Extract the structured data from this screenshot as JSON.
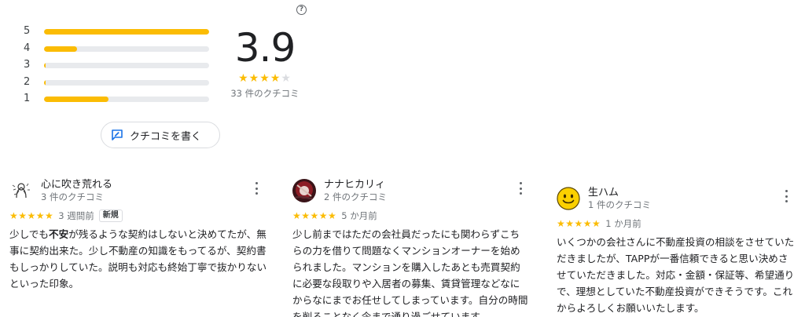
{
  "summary": {
    "distribution": [
      {
        "label": "5",
        "fraction": 1.0
      },
      {
        "label": "4",
        "fraction": 0.2
      },
      {
        "label": "3",
        "fraction": 0.01
      },
      {
        "label": "2",
        "fraction": 0.01
      },
      {
        "label": "1",
        "fraction": 0.39
      }
    ],
    "average": "3.9",
    "stars_display": "★★★★",
    "stars_empty": "★",
    "rating_value": 3.9,
    "count_text": "33 件のクチコミ",
    "help_icon_text": "?"
  },
  "write_review": {
    "label": "クチコミを書く"
  },
  "reviews": [
    {
      "name": "心に吹き荒れる",
      "sub": "3 件のクチコミ",
      "stars": "★★★★★",
      "date": "3 週間前",
      "badge": "新規",
      "text_part1": "少しでも",
      "text_bold": "不安",
      "text_part2": "が残るような契約はしないと決めてたが、無事に契約出来た。少し不動産の知識をもってるが、契約書もしっかりしていた。説明も対応も終始丁寧で抜かりないといった印象。"
    },
    {
      "name": "ナナヒカリィ",
      "sub": "2 件のクチコミ",
      "stars": "★★★★★",
      "date": "5 か月前",
      "text": "少し前まではただの会社員だったにも関わらずこちらの力を借りて問題なくマンションオーナーを始められました。マンションを購入したあとも売買契約に必要な段取りや入居者の募集、賃貸管理などなにからなにまでお任せしてしまっています。自分の時間を削ることなく今まで通り過ごせています。"
    },
    {
      "name": "生ハム",
      "sub": "1 件のクチコミ",
      "stars": "★★★★★",
      "date": "1 か月前",
      "text": "いくつかの会社さんに不動産投資の相談をさせていただきましたが、TAPPが一番信頼できると思い決めさせていただきました。対応・金額・保証等、希望通りで、理想としていた不動産投資ができそうです。これからよろしくお願いいたします。"
    }
  ],
  "colors": {
    "star": "#fbbc04",
    "track": "#e8eaed",
    "text": "#202124",
    "muted": "#70757a",
    "write_icon": "#1a73e8"
  }
}
